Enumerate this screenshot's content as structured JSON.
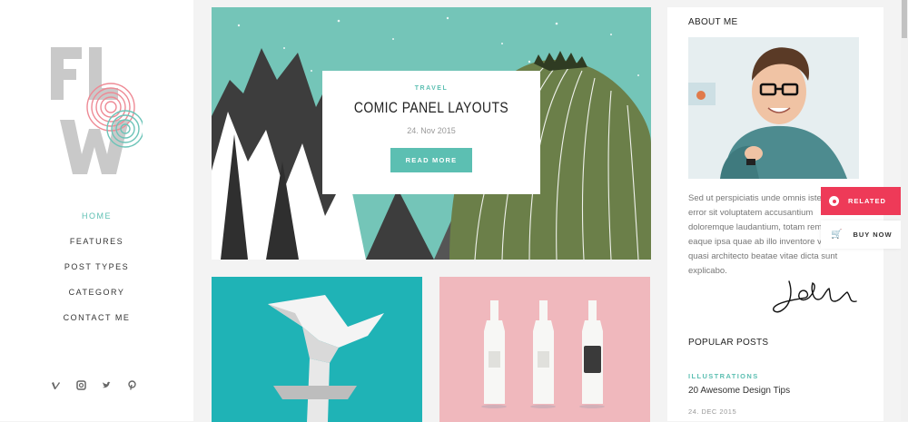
{
  "nav": {
    "items": [
      {
        "label": "HOME",
        "active": true
      },
      {
        "label": "FEATURES"
      },
      {
        "label": "POST TYPES"
      },
      {
        "label": "CATEGORY"
      },
      {
        "label": "CONTACT ME"
      }
    ]
  },
  "social": [
    "vimeo-icon",
    "instagram-icon",
    "twitter-icon",
    "pinterest-icon"
  ],
  "hero": {
    "category": "TRAVEL",
    "title": "COMIC PANEL LAYOUTS",
    "date": "24. Nov 2015",
    "button": "READ MORE"
  },
  "about": {
    "title": "ABOUT ME",
    "text": "Sed ut perspiciatis unde omnis iste natus error sit voluptatem accusantium doloremque laudantium, totam rem aperiam, eaque ipsa quae ab illo inventore veritatis et quasi architecto beatae vitae dicta sunt explicabo."
  },
  "popular": {
    "title": "POPULAR POSTS",
    "category": "ILLUSTRATIONS",
    "post_title": "20 Awesome Design Tips",
    "date": "24. DEC 2015"
  },
  "floating": {
    "related": "RELATED",
    "buy": "BUY NOW"
  },
  "colors": {
    "accent": "#5cbfb2",
    "related": "#ee3a58"
  }
}
